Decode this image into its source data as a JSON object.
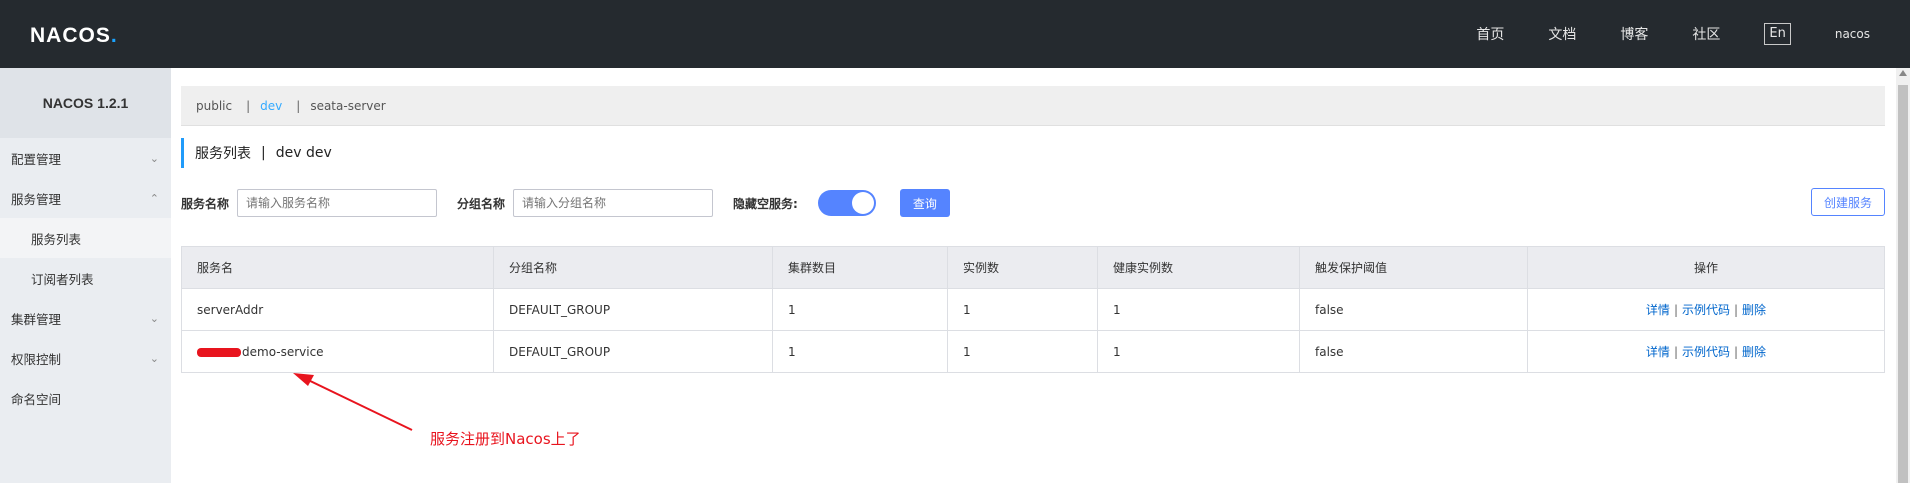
{
  "topbar": {
    "logo_prefix": "NACOS",
    "logo_suffix": ".",
    "nav": [
      "首页",
      "文档",
      "博客",
      "社区"
    ],
    "lang": "En",
    "user": "nacos"
  },
  "sidebar": {
    "version": "NACOS 1.2.1",
    "items": [
      {
        "label": "配置管理",
        "chevron": "chevron-down"
      },
      {
        "label": "服务管理",
        "chevron": "chevron-up"
      },
      {
        "label": "服务列表"
      },
      {
        "label": "订阅者列表"
      },
      {
        "label": "集群管理",
        "chevron": "chevron-down"
      },
      {
        "label": "权限控制",
        "chevron": "chevron-down"
      },
      {
        "label": "命名空间"
      }
    ]
  },
  "namespaces": {
    "items": [
      "public",
      "dev",
      "seata-server"
    ],
    "active": "dev"
  },
  "page": {
    "title": "服务列表",
    "namespace_name": "dev",
    "namespace_id": "dev"
  },
  "filters": {
    "service_label": "服务名称",
    "service_placeholder": "请输入服务名称",
    "group_label": "分组名称",
    "group_placeholder": "请输入分组名称",
    "hide_empty_label": "隐藏空服务:",
    "hide_empty_on": true,
    "query_button": "查询",
    "create_button": "创建服务"
  },
  "table": {
    "headers": [
      "服务名",
      "分组名称",
      "集群数目",
      "实例数",
      "健康实例数",
      "触发保护阈值",
      "操作"
    ],
    "rows": [
      {
        "name": "serverAddr",
        "group": "DEFAULT_GROUP",
        "clusters": "1",
        "instances": "1",
        "healthy": "1",
        "threshold": "false"
      },
      {
        "name": "demo-service",
        "group": "DEFAULT_GROUP",
        "clusters": "1",
        "instances": "1",
        "healthy": "1",
        "threshold": "false"
      }
    ],
    "actions": {
      "detail": "详情",
      "sample": "示例代码",
      "delete": "删除",
      "separator": "|"
    }
  },
  "annotation": {
    "text": "服务注册到Nacos上了",
    "color": "#e8141e"
  },
  "colors": {
    "topbar_bg": "#252a2f",
    "accent": "#5584ff",
    "link": "#0066cc",
    "namespace_active": "#33aaff"
  }
}
